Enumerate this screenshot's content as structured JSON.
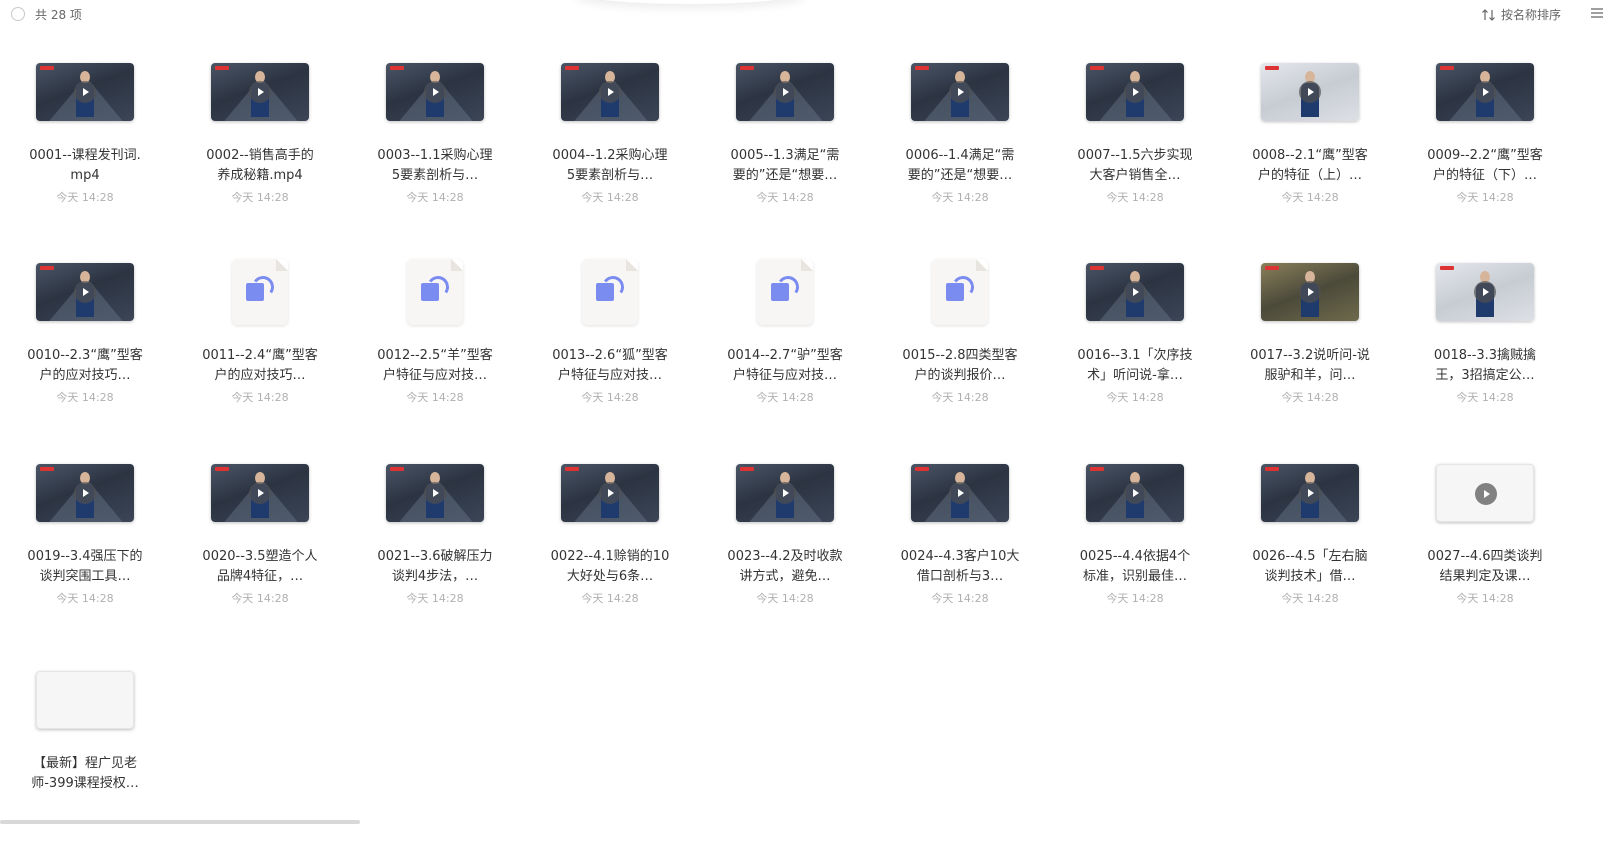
{
  "toolbar": {
    "count_label": "共 28 项",
    "sort_label": "按名称排序",
    "sort_icon": "sort-arrows-icon",
    "view_icon": "list-menu-icon"
  },
  "files": [
    {
      "name": "0001--课程发刊词.mp4",
      "date": "今天 14:28",
      "kind": "video",
      "style": "dark"
    },
    {
      "name": "0002--销售高手的养成秘籍.mp4",
      "date": "今天 14:28",
      "kind": "video",
      "style": "dark"
    },
    {
      "name": "0003--1.1采购心理5要素剖析与…",
      "date": "今天 14:28",
      "kind": "video",
      "style": "dark"
    },
    {
      "name": "0004--1.2采购心理5要素剖析与…",
      "date": "今天 14:28",
      "kind": "video",
      "style": "dark"
    },
    {
      "name": "0005--1.3满足“需要的”还是“想要…",
      "date": "今天 14:28",
      "kind": "video",
      "style": "dark"
    },
    {
      "name": "0006--1.4满足“需要的”还是“想要…",
      "date": "今天 14:28",
      "kind": "video",
      "style": "dark"
    },
    {
      "name": "0007--1.5六步实现大客户销售全…",
      "date": "今天 14:28",
      "kind": "video",
      "style": "dark"
    },
    {
      "name": "0008--2.1“鹰”型客户的特征（上）…",
      "date": "今天 14:28",
      "kind": "video",
      "style": "light"
    },
    {
      "name": "0009--2.2“鹰”型客户的特征（下）…",
      "date": "今天 14:28",
      "kind": "video",
      "style": "dark"
    },
    {
      "name": "0010--2.3“鹰”型客户的应对技巧…",
      "date": "今天 14:28",
      "kind": "video",
      "style": "dark"
    },
    {
      "name": "0011--2.4“鹰”型客户的应对技巧…",
      "date": "今天 14:28",
      "kind": "doc",
      "style": "doc"
    },
    {
      "name": "0012--2.5“羊”型客户特征与应对技…",
      "date": "今天 14:28",
      "kind": "doc",
      "style": "doc"
    },
    {
      "name": "0013--2.6“狐”型客户特征与应对技…",
      "date": "今天 14:28",
      "kind": "doc",
      "style": "doc"
    },
    {
      "name": "0014--2.7“驴”型客户特征与应对技…",
      "date": "今天 14:28",
      "kind": "doc",
      "style": "doc"
    },
    {
      "name": "0015--2.8四类型客户的谈判报价…",
      "date": "今天 14:28",
      "kind": "doc",
      "style": "doc"
    },
    {
      "name": "0016--3.1「次序技术」听问说-拿…",
      "date": "今天 14:28",
      "kind": "video",
      "style": "dark"
    },
    {
      "name": "0017--3.2说听问-说服驴和羊，问…",
      "date": "今天 14:28",
      "kind": "video",
      "style": "cam"
    },
    {
      "name": "0018--3.3擒贼擒王，3招搞定公…",
      "date": "今天 14:28",
      "kind": "video",
      "style": "light"
    },
    {
      "name": "0019--3.4强压下的谈判突围工具…",
      "date": "今天 14:28",
      "kind": "video",
      "style": "dark"
    },
    {
      "name": "0020--3.5塑造个人品牌4特征，…",
      "date": "今天 14:28",
      "kind": "video",
      "style": "dark"
    },
    {
      "name": "0021--3.6破解压力谈判4步法，…",
      "date": "今天 14:28",
      "kind": "video",
      "style": "dark"
    },
    {
      "name": "0022--4.1赊销的10大好处与6条…",
      "date": "今天 14:28",
      "kind": "video",
      "style": "dark"
    },
    {
      "name": "0023--4.2及时收款讲方式，避免…",
      "date": "今天 14:28",
      "kind": "video",
      "style": "dark"
    },
    {
      "name": "0024--4.3客户10大借口剖析与3…",
      "date": "今天 14:28",
      "kind": "video",
      "style": "dark"
    },
    {
      "name": "0025--4.4依据4个标准，识别最佳…",
      "date": "今天 14:28",
      "kind": "video",
      "style": "dark"
    },
    {
      "name": "0026--4.5「左右脑谈判技术」借…",
      "date": "今天 14:28",
      "kind": "video",
      "style": "dark"
    },
    {
      "name": "0027--4.6四类谈判结果判定及课…",
      "date": "今天 14:28",
      "kind": "video",
      "style": "paper"
    },
    {
      "name": "【最新】程广见老师-399课程授权…",
      "date": "",
      "kind": "image",
      "style": "paper"
    }
  ]
}
